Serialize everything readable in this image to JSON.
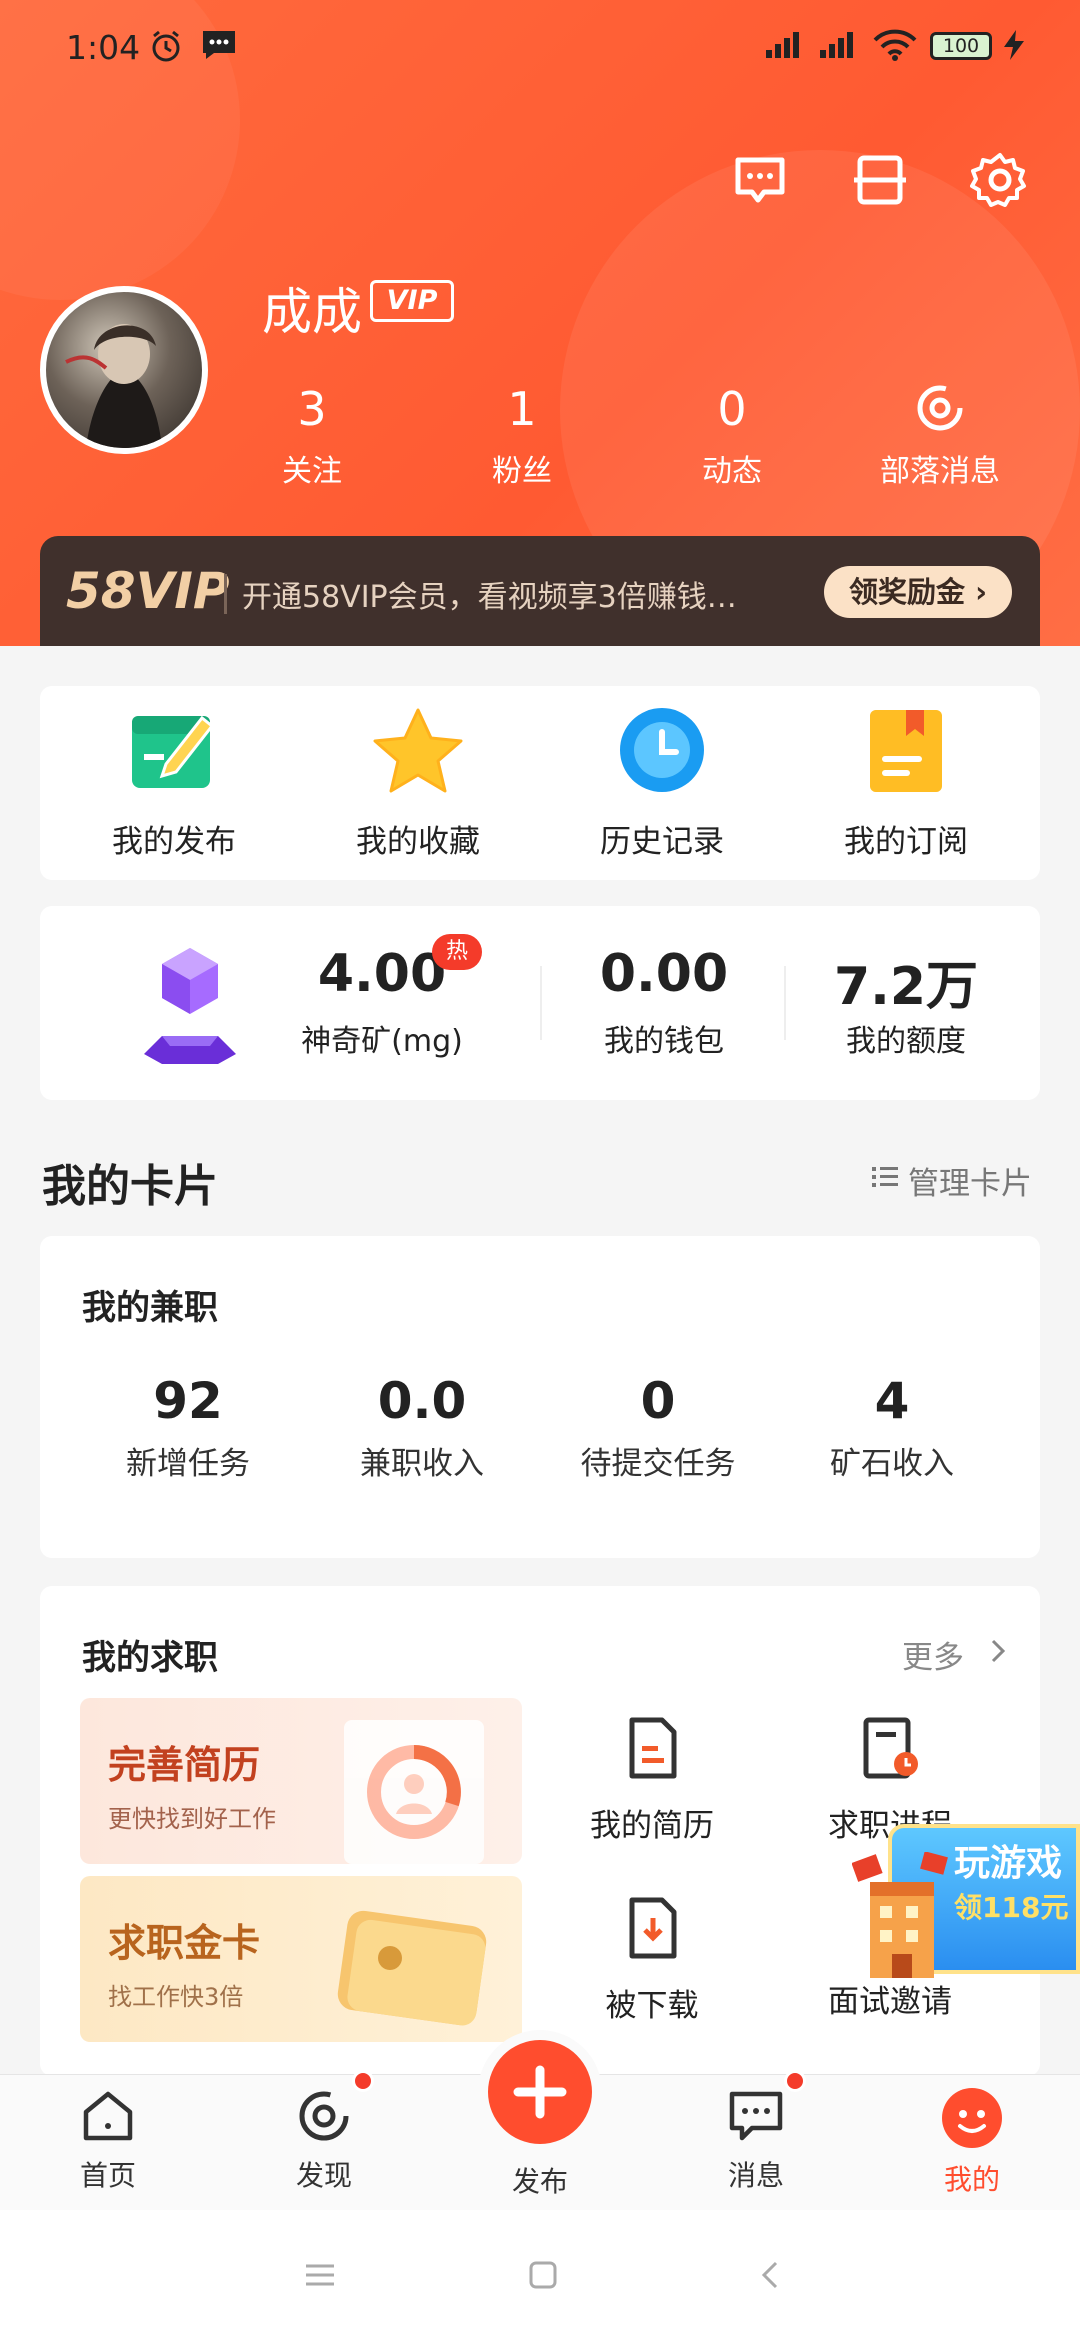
{
  "status_bar": {
    "time": "1:04",
    "battery": "100"
  },
  "profile": {
    "name": "成成",
    "vip_badge": "VIP"
  },
  "stats": [
    {
      "value": "3",
      "label": "关注"
    },
    {
      "value": "1",
      "label": "粉丝"
    },
    {
      "value": "0",
      "label": "动态"
    },
    {
      "label": "部落消息"
    }
  ],
  "vip_bar": {
    "logo": "58VIP",
    "text": "开通58VIP会员，看视频享3倍赚钱…",
    "button": "领奖励金 ›"
  },
  "quick_actions": [
    {
      "label": "我的发布",
      "icon": "publish-icon"
    },
    {
      "label": "我的收藏",
      "icon": "star-icon"
    },
    {
      "label": "历史记录",
      "icon": "clock-icon"
    },
    {
      "label": "我的订阅",
      "icon": "subscribe-icon"
    }
  ],
  "mineral": {
    "value": "4.00",
    "hot": "热",
    "label": "神奇矿(mg)"
  },
  "wallet": {
    "value": "0.00",
    "label": "我的钱包"
  },
  "quota": {
    "value": "7.2万",
    "label": "我的额度"
  },
  "cards_section": {
    "title": "我的卡片",
    "manage": "管理卡片"
  },
  "parttime": {
    "title": "我的兼职",
    "items": [
      {
        "value": "92",
        "label": "新增任务"
      },
      {
        "value": "0.0",
        "label": "兼职收入"
      },
      {
        "value": "0",
        "label": "待提交任务"
      },
      {
        "value": "4",
        "label": "矿石收入"
      }
    ]
  },
  "job": {
    "title": "我的求职",
    "more": "更多",
    "cards": [
      {
        "title": "完善简历",
        "sub": "更快找到好工作"
      },
      {
        "title": "求职金卡",
        "sub": "找工作快3倍"
      }
    ],
    "items": [
      {
        "label": "我的简历",
        "icon": "resume-icon"
      },
      {
        "label": "求职进程",
        "icon": "progress-doc-icon"
      },
      {
        "label": "被下载",
        "icon": "download-doc-icon"
      },
      {
        "label": "面试邀请",
        "icon": "interview-icon"
      }
    ]
  },
  "game_banner": {
    "title": "玩游戏",
    "sub": "领118元"
  },
  "tabs": [
    {
      "label": "首页",
      "icon": "home-icon"
    },
    {
      "label": "发现",
      "icon": "discover-icon"
    },
    {
      "label": "发布",
      "icon": "plus-icon"
    },
    {
      "label": "消息",
      "icon": "message-icon"
    },
    {
      "label": "我的",
      "icon": "profile-icon"
    }
  ],
  "colors": {
    "accent": "#ff5a32",
    "tab_active": "#ff4d2e",
    "badge": "#f43b2a"
  }
}
